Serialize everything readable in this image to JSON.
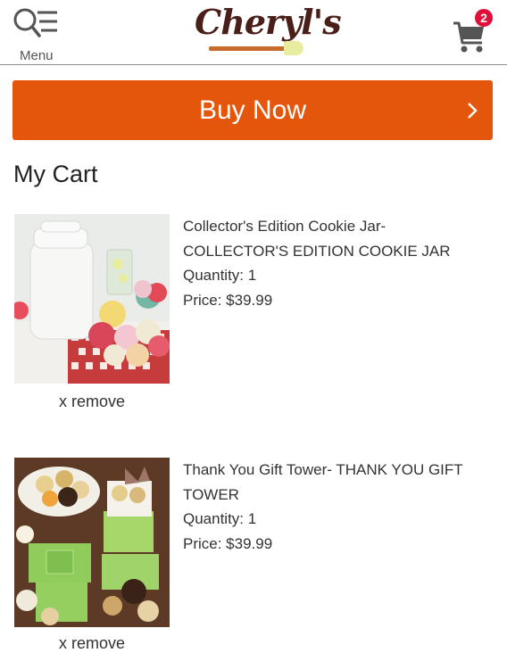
{
  "header": {
    "menu_label": "Menu",
    "logo_text": "Cheryl's",
    "cart_count": "2"
  },
  "buy_now": {
    "label": "Buy Now"
  },
  "cart": {
    "title": "My Cart",
    "items": [
      {
        "name": "Collector's Edition Cookie Jar- COLLECTOR'S EDITION COOKIE JAR",
        "quantity": "Quantity: 1",
        "price": "Price: $39.99",
        "remove_label": "x remove"
      },
      {
        "name": "Thank You Gift Tower- THANK YOU GIFT TOWER",
        "quantity": "Quantity: 1",
        "price": "Price: $39.99",
        "remove_label": "x remove"
      }
    ]
  },
  "colors": {
    "accent": "#e3560b",
    "badge": "#e0103a",
    "logo": "#4a1f1a"
  }
}
